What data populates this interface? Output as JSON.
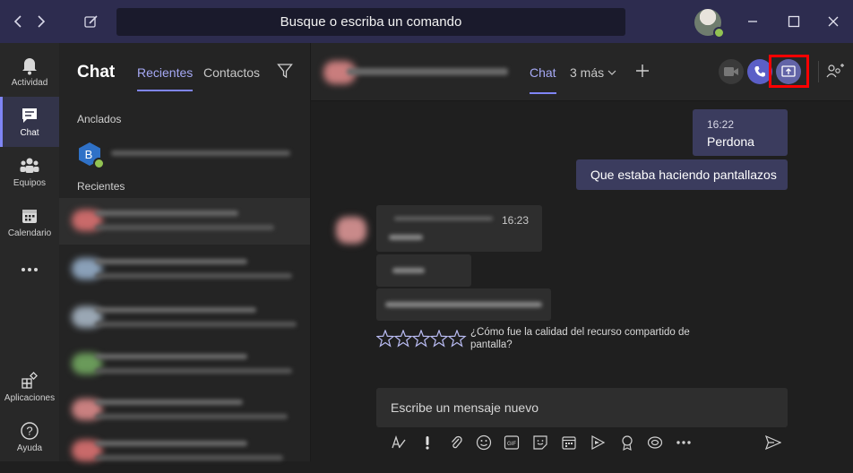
{
  "titlebar": {
    "back_icon": "chevron-left-icon",
    "forward_icon": "chevron-right-icon",
    "compose_icon": "compose-icon",
    "search_placeholder": "Busque o escriba un comando",
    "window_controls": [
      "minimize-icon",
      "maximize-icon",
      "close-icon"
    ]
  },
  "rail": {
    "items": [
      {
        "label": "Actividad",
        "icon": "bell-icon"
      },
      {
        "label": "Chat",
        "icon": "chat-icon",
        "active": true
      },
      {
        "label": "Equipos",
        "icon": "teams-icon"
      },
      {
        "label": "Calendario",
        "icon": "calendar-icon"
      },
      {
        "label": "",
        "icon": "more-icon"
      },
      {
        "label": "Aplicaciones",
        "icon": "apps-icon"
      },
      {
        "label": "Ayuda",
        "icon": "help-icon"
      }
    ]
  },
  "chatlist": {
    "title": "Chat",
    "tabs": [
      {
        "label": "Recientes",
        "active": true
      },
      {
        "label": "Contactos"
      }
    ],
    "filter_icon": "filter-icon",
    "pinned_label": "Anclados",
    "pinned_avatar_initial": "B",
    "recent_label": "Recientes"
  },
  "conversation": {
    "tabs": [
      {
        "label": "Chat",
        "active": true
      },
      {
        "label": "3 más"
      }
    ],
    "add_tab_icon": "plus-icon",
    "actions": [
      "video-call-icon",
      "audio-call-icon",
      "share-screen-icon",
      "add-people-icon"
    ],
    "highlight_color": "#ff0000",
    "messages_me": [
      {
        "time": "16:22",
        "text": "Perdona"
      },
      {
        "time": "",
        "text": "Que estaba haciendo pantallazos"
      }
    ],
    "message_other_time": "16:23",
    "rating_prompt_line1": "¿Cómo fue la calidad del recurso compartido de",
    "rating_prompt_line2": "pantalla?",
    "rating_stars": 5,
    "compose_placeholder": "Escribe un mensaje nuevo",
    "compose_tools": [
      "format-icon",
      "important-icon",
      "attach-icon",
      "emoji-icon",
      "gif-icon",
      "sticker-icon",
      "schedule-meeting-icon",
      "stream-icon",
      "praise-icon",
      "loop-icon",
      "more-icon"
    ],
    "send_icon": "send-icon"
  },
  "colors": {
    "accent": "#7f85f5",
    "titlebar": "#2d2c4f",
    "presence": "#92c353"
  }
}
